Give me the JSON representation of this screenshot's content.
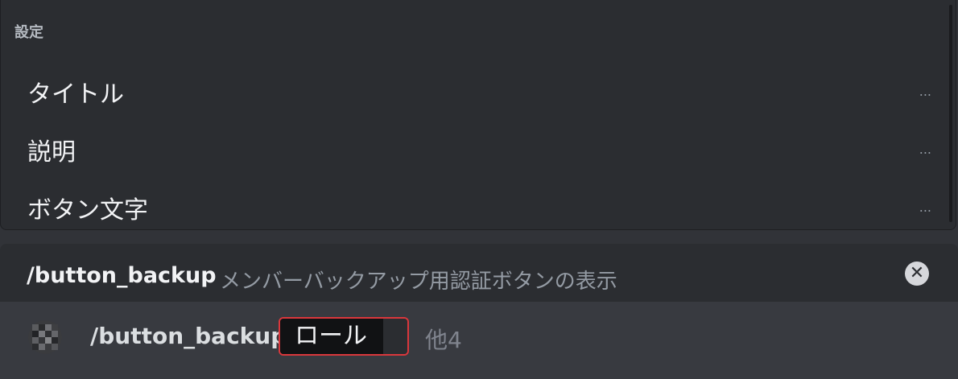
{
  "options_popup": {
    "section_title": "設定",
    "items": [
      {
        "label": "タイトル",
        "more": "..."
      },
      {
        "label": "説明",
        "more": "..."
      },
      {
        "label": "ボタン文字",
        "more": "..."
      }
    ]
  },
  "command_preview": {
    "name": "/button_backup",
    "description": "メンバーバックアップ用認証ボタンの表示",
    "close_icon": "close-circle-icon"
  },
  "input": {
    "avatar_icon": "bot-avatar-icon",
    "command": "/button_backup",
    "param_label": "ロール",
    "more_params": "他4"
  },
  "colors": {
    "background": "#313338",
    "panel": "#2b2d31",
    "input_bg": "#383a40",
    "error_border": "#da373c",
    "text_primary": "#f2f3f5",
    "text_muted": "#949ba4"
  }
}
